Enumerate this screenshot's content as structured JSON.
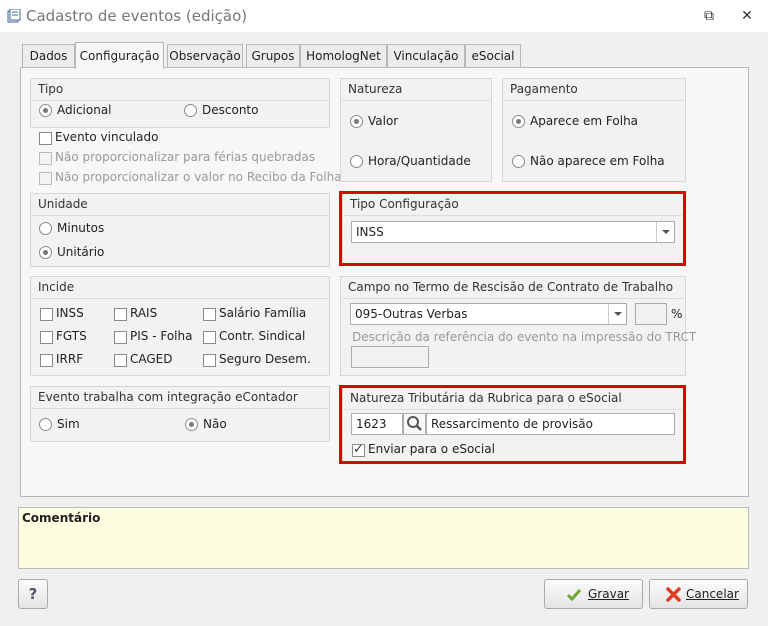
{
  "window": {
    "title": "Cadastro de eventos (edição)",
    "restore_glyph": "⧉",
    "close_glyph": "✕"
  },
  "tabs": [
    "Dados",
    "Configuração",
    "Observação",
    "Grupos",
    "HomologNet",
    "Vinculação",
    "eSocial"
  ],
  "tipo": {
    "title": "Tipo",
    "adicional": "Adicional",
    "desconto": "Desconto"
  },
  "flags": {
    "evento_vinculado": "Evento vinculado",
    "nao_prop_ferias": "Não proporcionalizar para férias quebradas",
    "nao_prop_recibo": "Não proporcionalizar o valor no Recibo da Folha"
  },
  "natureza": {
    "title": "Natureza",
    "valor": "Valor",
    "hora": "Hora/Quantidade"
  },
  "pagamento": {
    "title": "Pagamento",
    "aparece": "Aparece em Folha",
    "nao_aparece": "Não aparece em Folha"
  },
  "unidade": {
    "title": "Unidade",
    "minutos": "Minutos",
    "unitario": "Unitário"
  },
  "tipo_config": {
    "title": "Tipo Configuração",
    "value": "INSS"
  },
  "incide": {
    "title": "Incide",
    "inss": "INSS",
    "rais": "RAIS",
    "salario_familia": "Salário Família",
    "fgts": "FGTS",
    "pis": "PIS - Folha",
    "contr_sindical": "Contr. Sindical",
    "irrf": "IRRF",
    "caged": "CAGED",
    "seguro": "Seguro Desem."
  },
  "trct": {
    "title": "Campo no Termo de Rescisão de Contrato de Trabalho",
    "value": "095-Outras Verbas",
    "percent": "%",
    "descricao_label": "Descrição da referência do evento na impressão do TRCT"
  },
  "econtador": {
    "title": "Evento trabalha com integração eContador",
    "sim": "Sim",
    "nao": "Não"
  },
  "natureza_tributaria": {
    "title": "Natureza Tributária da Rubrica para o eSocial",
    "code": "1623",
    "desc": "Ressarcimento de provisão",
    "enviar": "Enviar para o eSocial"
  },
  "comentario": {
    "label": "Comentário"
  },
  "buttons": {
    "help": "?",
    "gravar": "Gravar",
    "cancelar": "Cancelar"
  },
  "colors": {
    "highlight": "#e00000",
    "comment_bg": "#fdfde1"
  }
}
